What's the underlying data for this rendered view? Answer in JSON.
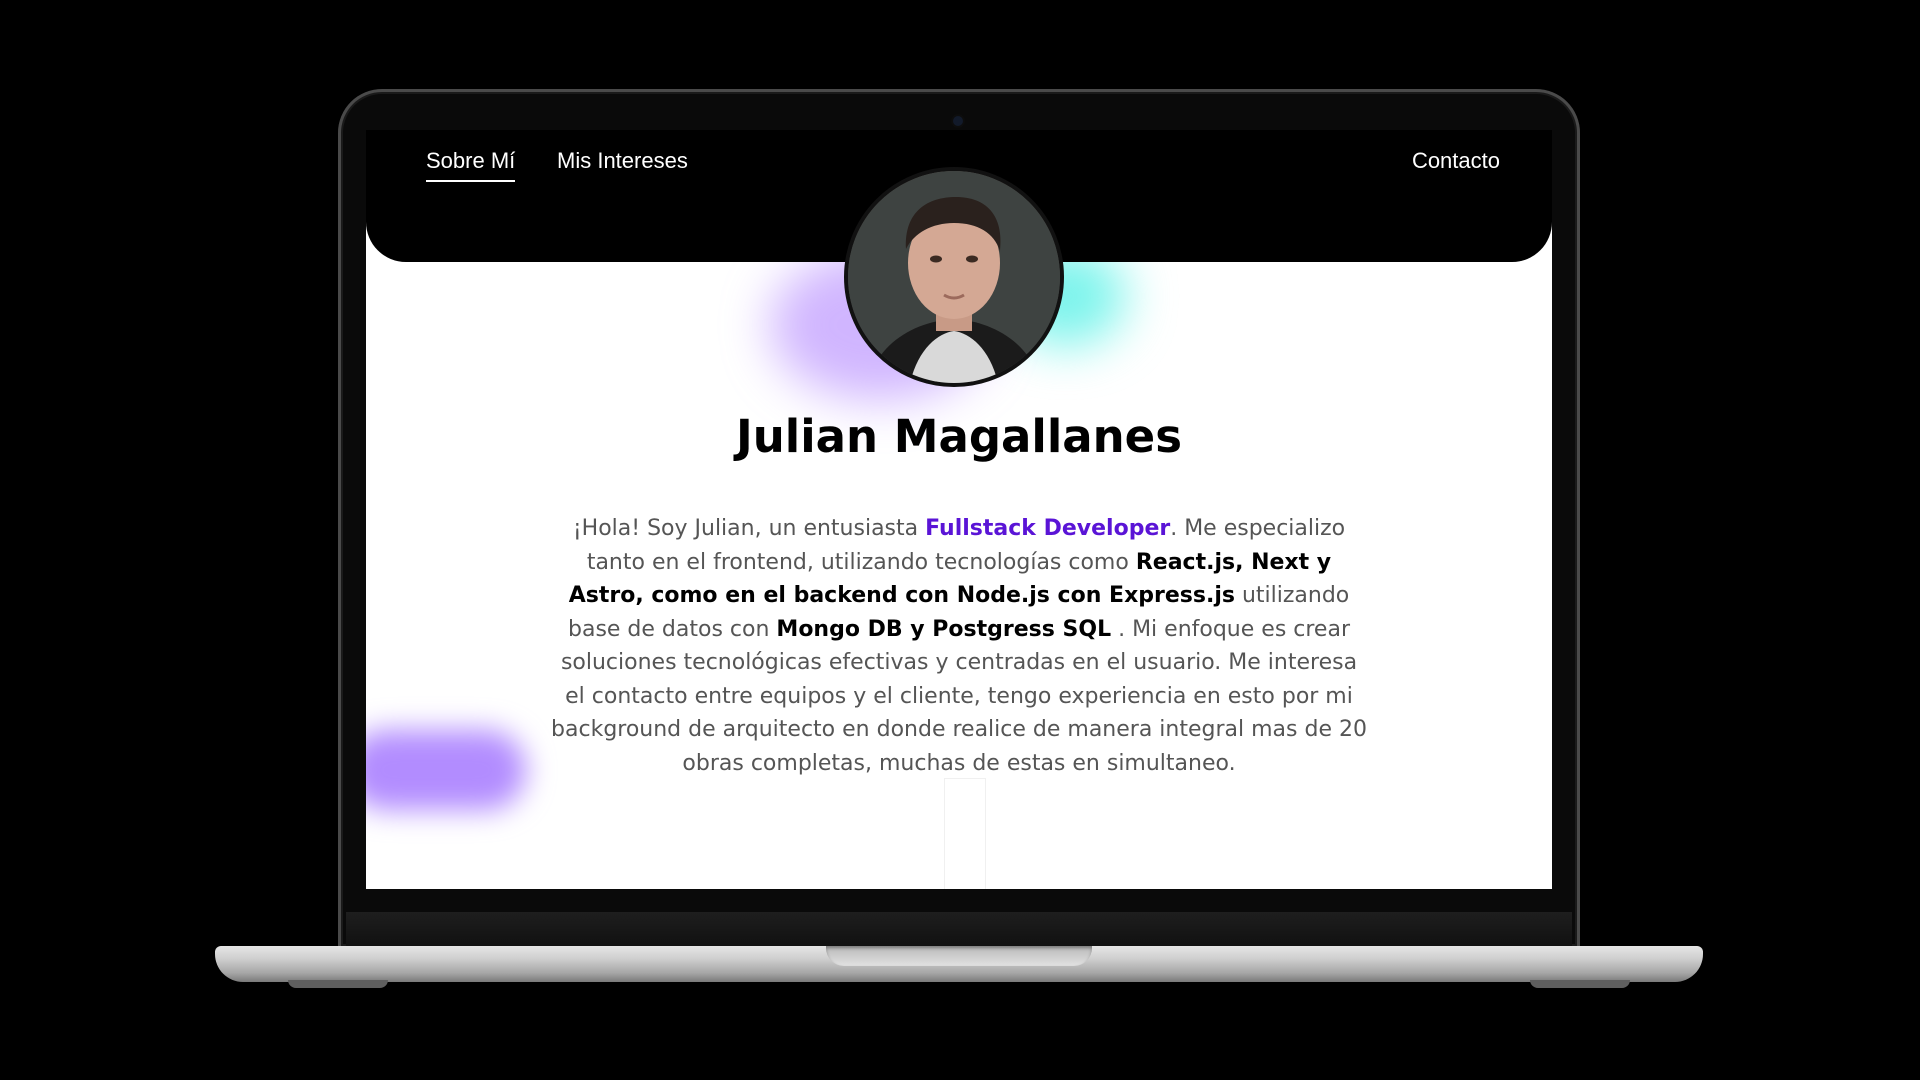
{
  "nav": {
    "items": [
      {
        "label": "Sobre Mí",
        "active": true
      },
      {
        "label": "Mis Intereses",
        "active": false
      }
    ],
    "contact_label": "Contacto"
  },
  "profile": {
    "name": "Julian Magallanes",
    "avatar_icon": "profile-photo"
  },
  "bio": {
    "t1": "¡Hola! Soy Julian, un entusiasta ",
    "role": "Fullstack Developer",
    "t2": ". Me especializo tanto en el frontend, utilizando tecnologías como ",
    "stack_front": "React.js, Next y Astro, como en el backend con Node.js con Express.js",
    "t3": " utilizando base de datos con ",
    "stack_db": "Mongo DB y Postgress SQL",
    "t4": " . Mi enfoque es crear soluciones tecnológicas efectivas y centradas en el usuario. Me interesa el contacto entre equipos y el cliente, tengo experiencia en esto por mi background de arquitecto en donde realice de manera integral mas de 20 obras completas, muchas de estas en simultaneo."
  },
  "colors": {
    "accent": "#5a14d6",
    "glow_purple": "#a878ff",
    "glow_cyan": "#50f0e6"
  }
}
